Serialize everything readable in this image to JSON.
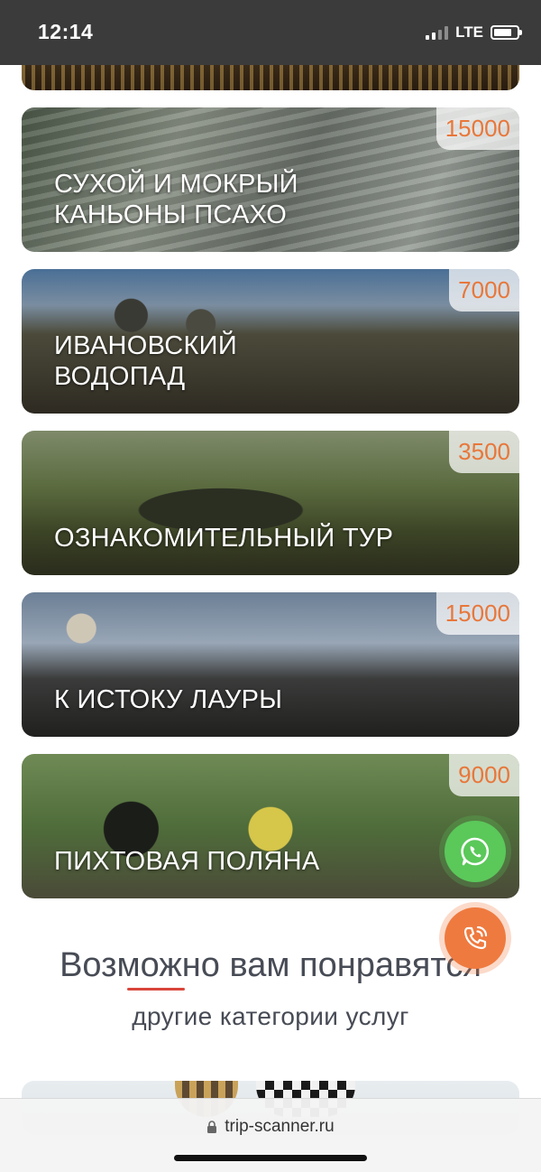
{
  "status_bar": {
    "time": "12:14",
    "network": "LTE",
    "signal_bars": 4,
    "signal_bars_active": 2,
    "battery_level": 0.8
  },
  "tours": [
    {
      "title": "СУХОЙ И МОКРЫЙ КАНЬОНЫ ПСАХО",
      "price": "15000"
    },
    {
      "title": "ИВАНОВСКИЙ ВОДОПАД",
      "price": "7000"
    },
    {
      "title": "ОЗНАКОМИТЕЛЬНЫЙ ТУР",
      "price": "3500"
    },
    {
      "title": "К ИСТОКУ ЛАУРЫ",
      "price": "15000"
    },
    {
      "title": "ПИХТОВАЯ ПОЛЯНА",
      "price": "9000"
    }
  ],
  "recommend": {
    "title": "Возможно вам понравятся",
    "subtitle": "другие категории услуг"
  },
  "floating_buttons": {
    "whatsapp_icon": "whatsapp-icon",
    "call_icon": "phone-call-icon"
  },
  "browser": {
    "url": "trip-scanner.ru",
    "lock_icon": "lock-icon"
  },
  "colors": {
    "price_text": "#e8773a",
    "whatsapp": "#5bc85a",
    "call": "#ef7a3f",
    "accent_underline": "#d9453b"
  }
}
